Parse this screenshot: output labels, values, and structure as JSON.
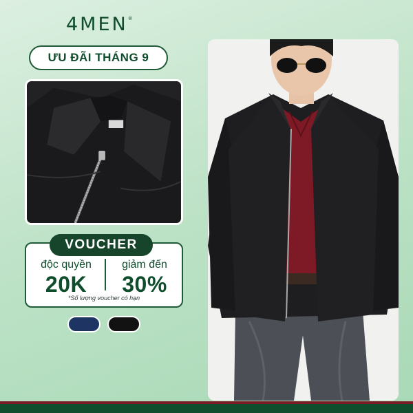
{
  "brand": {
    "name": "4MEN",
    "trademark": "®"
  },
  "promo": {
    "title": "ƯU ĐÃI THÁNG 9"
  },
  "voucher": {
    "badge": "VOUCHER",
    "left_label": "độc quyền",
    "left_value": "20K",
    "right_label": "giảm đến",
    "right_value": "30%",
    "note": "*Số lượng voucher có hạn"
  },
  "color_swatches": [
    {
      "name": "navy",
      "color": "#1e3563"
    },
    {
      "name": "black",
      "color": "#121212"
    }
  ],
  "colors": {
    "brand_green": "#0f4d2c",
    "background_mint": "#bfe3c8",
    "accent_red": "#7a1c26"
  },
  "images": {
    "detail": "jacket-collar-zipper-closeup",
    "model": "model-wearing-black-denim-jacket"
  }
}
